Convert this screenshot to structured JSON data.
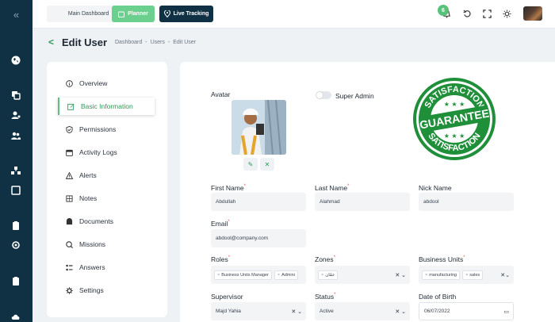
{
  "topbar": {
    "dashboard_select": "Main Dashboard",
    "planner_label": "Planner",
    "tracking_label": "Live Tracking",
    "notification_count": "6"
  },
  "header": {
    "title": "Edit User",
    "breadcrumb": [
      "Dashboard",
      "-",
      "Users",
      "-",
      "Edit User"
    ]
  },
  "menu": {
    "items": [
      {
        "label": "Overview",
        "icon": "info-icon"
      },
      {
        "label": "Basic Information",
        "icon": "edit-icon",
        "active": true
      },
      {
        "label": "Permissions",
        "icon": "shield-icon"
      },
      {
        "label": "Activity Logs",
        "icon": "calendar-icon"
      },
      {
        "label": "Alerts",
        "icon": "warning-icon"
      },
      {
        "label": "Notes",
        "icon": "note-icon"
      },
      {
        "label": "Documents",
        "icon": "document-icon"
      },
      {
        "label": "Missions",
        "icon": "mission-icon"
      },
      {
        "label": "Answers",
        "icon": "list-icon"
      },
      {
        "label": "Settings",
        "icon": "gear-icon"
      }
    ]
  },
  "form": {
    "avatar_label": "Avatar",
    "super_admin_label": "Super Admin",
    "first_name": {
      "label": "First Name",
      "value": "Abdullah"
    },
    "last_name": {
      "label": "Last Name",
      "value": "Alahmad"
    },
    "nick_name": {
      "label": "Nick Name",
      "value": "abdool"
    },
    "email": {
      "label": "Email",
      "value": "abdool@company.com"
    },
    "roles": {
      "label": "Roles",
      "chips": [
        "Business Units Manager",
        "Admini"
      ]
    },
    "zones": {
      "label": "Zones",
      "chips": [
        "عمّان"
      ]
    },
    "business_units": {
      "label": "Business Units",
      "chips": [
        "manufacturing",
        "sales"
      ]
    },
    "supervisor": {
      "label": "Supervisor",
      "value": "Majd Yahia"
    },
    "status": {
      "label": "Status",
      "value": "Active"
    },
    "date_of_birth": {
      "label": "Date of Birth",
      "value": "06/07/2022"
    }
  },
  "seal": {
    "top_text": "SATISFACTION",
    "center_text": "GUARANTEE",
    "bottom_text": "SATISFACTION"
  },
  "colors": {
    "sidebar": "#0f3143",
    "accent": "#2d9b56",
    "planner": "#6bd08e"
  }
}
